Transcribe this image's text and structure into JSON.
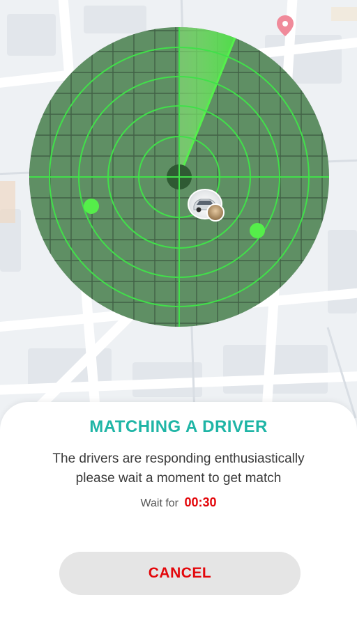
{
  "colors": {
    "title": "#1fb5a6",
    "accent_red": "#e3070b",
    "radar_fill": "#5f8f64",
    "radar_line": "#41e04a",
    "button_bg": "#e5e5e5"
  },
  "map": {
    "pin_icon": "location-pin-icon"
  },
  "radar": {
    "driver_icon": "car-icon",
    "passenger_icon": "user-photo-icon"
  },
  "sheet": {
    "title": "MATCHING A DRIVER",
    "message_line1": "The drivers are responding enthusiastically",
    "message_line2": "please wait a moment to get match",
    "wait_label": "Wait for",
    "wait_time": "00:30",
    "cancel_label": "CANCEL"
  }
}
